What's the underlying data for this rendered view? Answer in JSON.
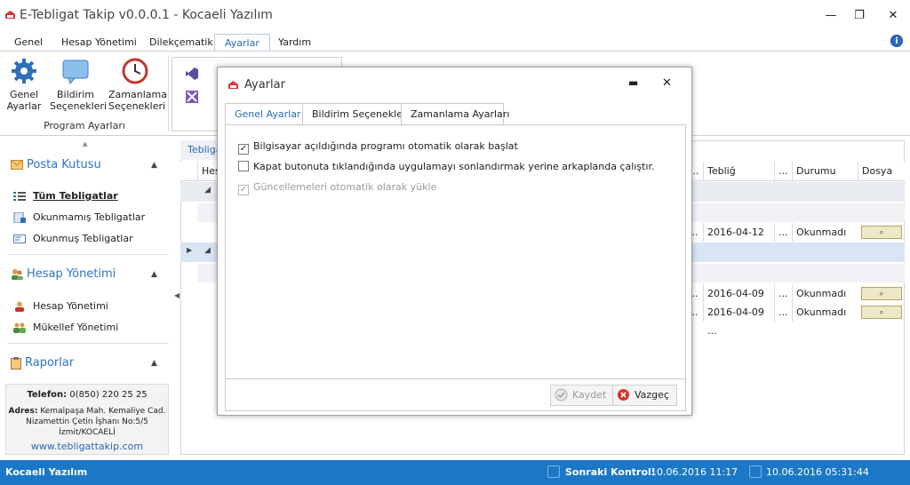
{
  "window": {
    "title": "E-Tebligat Takip v0.0.0.1 - Kocaeli Yazılım",
    "minimize": "—",
    "restore": "❐",
    "close": "✕"
  },
  "menu": {
    "tabs": [
      "Genel",
      "Hesap Yönetimi",
      "Dilekçematik",
      "Ayarlar",
      "Yardım"
    ],
    "active": "Ayarlar",
    "info_icon": "info-icon"
  },
  "ribbon": {
    "buttons": [
      {
        "label1": "Genel",
        "label2": "Ayarlar",
        "icon": "gear-icon"
      },
      {
        "label1": "Bildirim",
        "label2": "Seçenekleri",
        "icon": "speech-bubble-icon"
      },
      {
        "label1": "Zamanlama",
        "label2": "Seçenekleri",
        "icon": "clock-icon"
      }
    ],
    "group_label": "Program Ayarları"
  },
  "sidebar": {
    "groups": [
      {
        "label": "Posta Kutusu",
        "icon": "envelope-icon"
      },
      {
        "label": "Hesap Yönetimi",
        "icon": "users-icon"
      },
      {
        "label": "Raporlar",
        "icon": "clipboard-icon"
      }
    ],
    "items": [
      {
        "label": "Tüm Tebligatlar",
        "icon": "list-icon"
      },
      {
        "label": "Okunmamış Tebligatlar",
        "icon": "unread-icon"
      },
      {
        "label": "Okunmuş Tebligatlar",
        "icon": "read-icon"
      },
      {
        "label": "Hesap Yönetimi",
        "icon": "user-icon"
      },
      {
        "label": "Mükellef Yönetimi",
        "icon": "people-icon"
      }
    ],
    "contact": {
      "phone_label": "Telefon:",
      "phone": "0(850) 220 25 25",
      "address_label": "Adres:",
      "address_line1": "Kemalpaşa Mah. Kemaliye Cad.",
      "address_line2": "Nizamettin Çetin İşhanı No:5/5",
      "address_line3": "İzmit/KOCAELİ",
      "website": "www.tebligattakip.com"
    }
  },
  "grid": {
    "tab_label": "Tebligat",
    "headers": {
      "hes": "Hes",
      "dots1": "...",
      "teblig_zamani": "Tebliğ Zamanı",
      "dots2": "...",
      "durumu": "Durumu",
      "dosya": "Dosya"
    },
    "rows": [
      {
        "dots": "...",
        "date": "2016-04-12 ...",
        "dots2": "...",
        "status": "Okunmadı"
      },
      {
        "dots": "...",
        "date": "2016-04-09 ...",
        "dots2": "...",
        "status": "Okunmadı"
      },
      {
        "dots": "...",
        "date": "2016-04-09 ...",
        "dots2": "...",
        "status": "Okunmadı"
      }
    ]
  },
  "status": {
    "company": "Kocaeli Yazılım",
    "next_label": "Sonraki Kontrol:",
    "next_value": "10.06.2016 11:17",
    "clock": "10.06.2016 05:31:44"
  },
  "dialog": {
    "title": "Ayarlar",
    "min": "▬",
    "close": "✕",
    "tabs": [
      "Genel Ayarlar",
      "Bildirim Seçenekleri",
      "Zamanlama Ayarları"
    ],
    "active_tab": "Genel Ayarlar",
    "options": [
      {
        "label": "Bilgisayar açıldığında programı otomatik olarak başlat",
        "checked": true,
        "enabled": true
      },
      {
        "label": "Kapat butonuta tıklandığında uygulamayı sonlandırmak yerine arkaplanda çalıştır.",
        "checked": false,
        "enabled": true
      },
      {
        "label": "Güncellemeleri otomatik olarak yükle",
        "checked": true,
        "enabled": false
      }
    ],
    "save_label": "Kaydet",
    "cancel_label": "Vazgeç",
    "checkmark": "✓"
  }
}
